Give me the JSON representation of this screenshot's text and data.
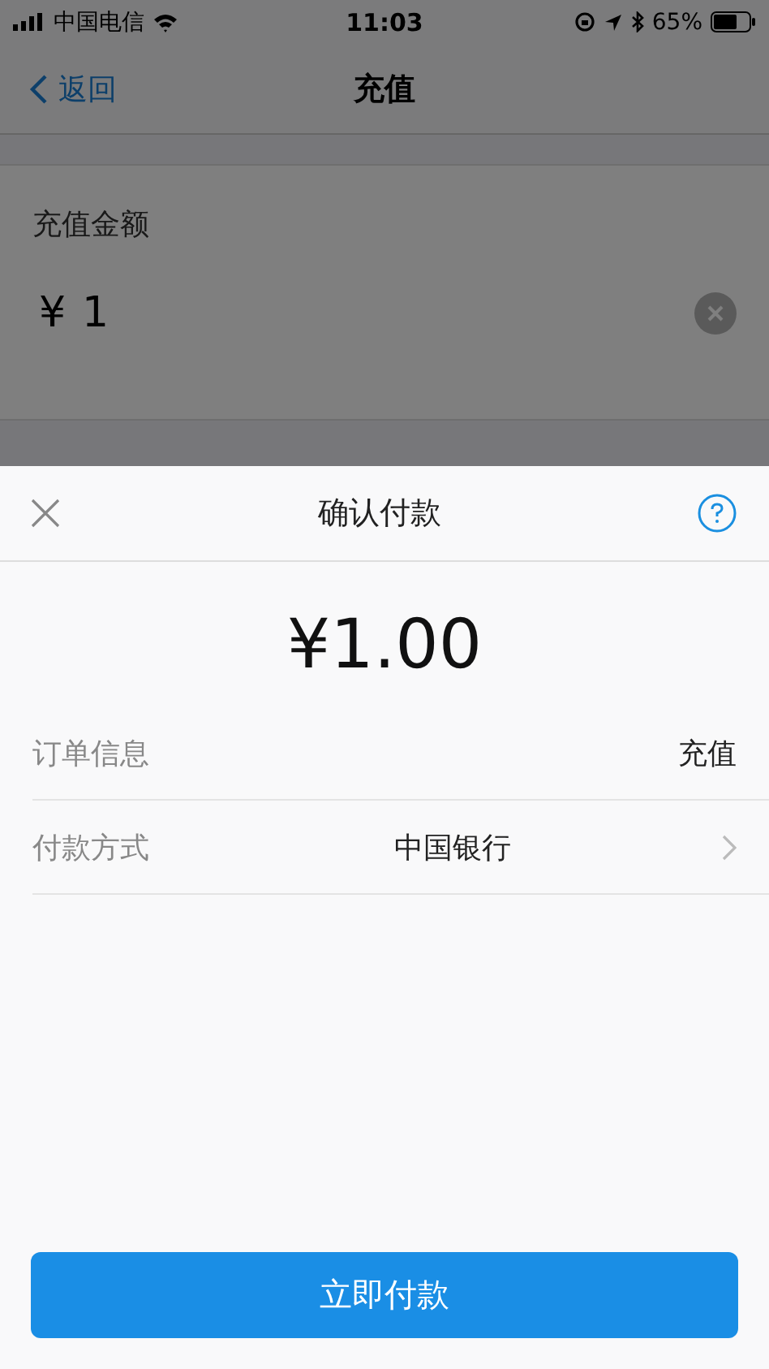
{
  "status_bar": {
    "carrier": "中国电信",
    "time": "11:03",
    "battery": "65%"
  },
  "nav": {
    "back": "返回",
    "title": "充值"
  },
  "recharge": {
    "label": "充值金额",
    "currency": "¥",
    "value": "1"
  },
  "sheet": {
    "title": "确认付款",
    "amount": "¥1.00",
    "rows": [
      {
        "label": "订单信息",
        "value": "充值",
        "kind": "info"
      },
      {
        "label": "付款方式",
        "value": "中国银行",
        "kind": "select"
      }
    ],
    "pay_button": "立即付款"
  }
}
